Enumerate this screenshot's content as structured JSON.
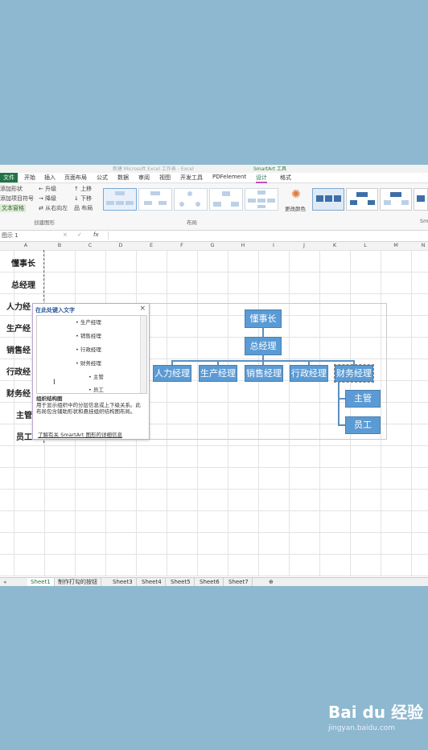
{
  "title_bar": {
    "left": "新建 Microsoft Excel 工作表 - Excel",
    "right": "SmartArt 工具"
  },
  "tabs": [
    "文件",
    "开始",
    "插入",
    "页面布局",
    "公式",
    "数据",
    "审阅",
    "视图",
    "开发工具",
    "PDFelement",
    "设计",
    "格式"
  ],
  "ribbon": {
    "create_group": [
      "添加形状",
      "添加项目符号",
      "文本窗格",
      "升级",
      "降级",
      "从右向左",
      "上移",
      "下移",
      "布局"
    ],
    "group_labels": [
      "创建图形",
      "布局",
      "Sm"
    ],
    "change_colors": "更改颜色"
  },
  "formula_bar": {
    "name_box": "图示 1",
    "cancel": "×",
    "enter": "✓",
    "fx": "fx"
  },
  "columns": [
    "A",
    "B",
    "C",
    "D",
    "E",
    "F",
    "G",
    "H",
    "I",
    "J",
    "K",
    "L",
    "M",
    "N"
  ],
  "row_labels": [
    "懂事长",
    "总经理",
    "人力经",
    "生产经",
    "销售经",
    "行政经",
    "财务经",
    "主管",
    "员工"
  ],
  "text_pane": {
    "title": "在此处键入文字",
    "close": "×",
    "items": [
      "生产经理",
      "销售经理",
      "行政经理",
      "财务经理",
      "主管",
      "员工"
    ],
    "desc_title": "组织结构图",
    "desc_body": "用于显示组织中的分层信息或上下级关系。此布局包含辅助形状和悬挂组织结构图布局。",
    "link": "了解有关 SmartArt 图形的详细信息"
  },
  "org_chart": {
    "top": "懂事长",
    "second": "总经理",
    "managers": [
      "人力经理",
      "生产经理",
      "销售经理",
      "行政经理",
      "财务经理"
    ],
    "subs": [
      "主管",
      "员工"
    ]
  },
  "sheets": [
    "Sheet1",
    "制作打勾的按钮",
    "Sheet3",
    "Sheet4",
    "Sheet5",
    "Sheet6",
    "Sheet7"
  ],
  "watermark": {
    "brand": "Bai du 经验",
    "url": "jingyan.baidu.com"
  }
}
